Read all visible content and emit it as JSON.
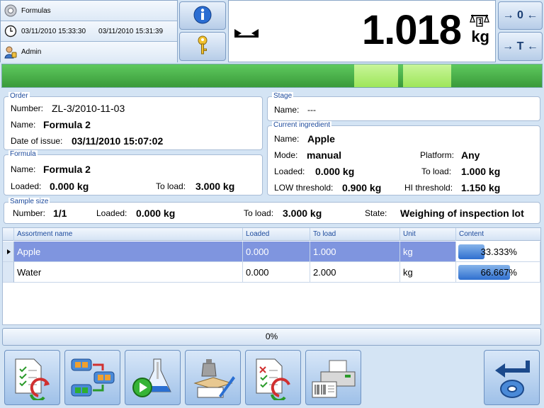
{
  "status": {
    "app_name": "Formulas",
    "datetime_now": "03/11/2010 15:33:30",
    "datetime_start": "03/11/2010 15:31:39",
    "user": "Admin"
  },
  "display": {
    "weight": "1.018",
    "unit": "kg",
    "scale_label": "1"
  },
  "buttons": {
    "zero_label": "→ 0 ←",
    "tare_label": "→ T ←"
  },
  "order": {
    "legend": "Order",
    "number_label": "Number:",
    "number_value": "ZL-3/2010-11-03",
    "name_label": "Name:",
    "name_value": "Formula 2",
    "date_label": "Date of issue:",
    "date_value": "03/11/2010 15:07:02"
  },
  "formula": {
    "legend": "Formula",
    "name_label": "Name:",
    "name_value": "Formula 2",
    "loaded_label": "Loaded:",
    "loaded_value": "0.000 kg",
    "toload_label": "To load:",
    "toload_value": "3.000 kg"
  },
  "stage": {
    "legend": "Stage",
    "name_label": "Name:",
    "name_value": "---"
  },
  "ingredient": {
    "legend": "Current ingredient",
    "name_label": "Name:",
    "name_value": "Apple",
    "mode_label": "Mode:",
    "mode_value": "manual",
    "platform_label": "Platform:",
    "platform_value": "Any",
    "loaded_label": "Loaded:",
    "loaded_value": "0.000 kg",
    "toload_label": "To load:",
    "toload_value": "1.000 kg",
    "low_label": "LOW threshold:",
    "low_value": "0.900 kg",
    "hi_label": "HI threshold:",
    "hi_value": "1.150 kg"
  },
  "sample": {
    "legend": "Sample size",
    "number_label": "Number:",
    "number_value": "1/1",
    "loaded_label": "Loaded:",
    "loaded_value": "0.000 kg",
    "toload_label": "To load:",
    "toload_value": "3.000 kg",
    "state_label": "State:",
    "state_value": "Weighing of inspection lot"
  },
  "table": {
    "columns": [
      "Assortment name",
      "Loaded",
      "To load",
      "Unit",
      "Content"
    ],
    "rows": [
      {
        "name": "Apple",
        "loaded": "0.000",
        "toload": "1.000",
        "unit": "kg",
        "content": "33.333%",
        "fraction": 0.33333
      },
      {
        "name": "Water",
        "loaded": "0.000",
        "toload": "2.000",
        "unit": "kg",
        "content": "66.667%",
        "fraction": 0.66667
      }
    ]
  },
  "overall_progress": {
    "text": "0%",
    "fraction": 0
  },
  "icons": {
    "app": "gear-icon",
    "clock": "clock-icon",
    "user": "user-icon",
    "info": "info-icon",
    "key": "key-icon"
  },
  "colors": {
    "selected_row": "#7f95df",
    "bargraph": "#4cb84c",
    "bargraph_highlight": "#b4ee7a",
    "progress_fill": "#2f6fcf"
  }
}
